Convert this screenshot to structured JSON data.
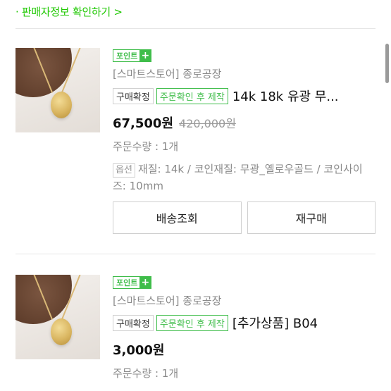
{
  "seller_link": "· 판매자정보 확인하기 >",
  "orders": [
    {
      "point_badge": "포인트",
      "point_plus": "+",
      "store": "[스마트스토어] 종로공장",
      "status_tag": "구매확정",
      "production_tag": "주문확인 후 제작",
      "product_name": "14k 18k 유광 무...",
      "price": "67,500원",
      "original_price": "420,000원",
      "quantity": "주문수량 : 1개",
      "option_label": "옵션",
      "option_text": "재질: 14k / 코인재질: 무광_옐로우골드 / 코인사이즈: 10mm",
      "buttons": [
        "배송조회",
        "재구매"
      ]
    },
    {
      "point_badge": "포인트",
      "point_plus": "+",
      "store": "[스마트스토어] 종로공장",
      "status_tag": "구매확정",
      "production_tag": "주문확인 후 제작",
      "product_name": "[추가상품] B04",
      "price": "3,000원",
      "quantity": "주문수량 : 1개"
    }
  ]
}
